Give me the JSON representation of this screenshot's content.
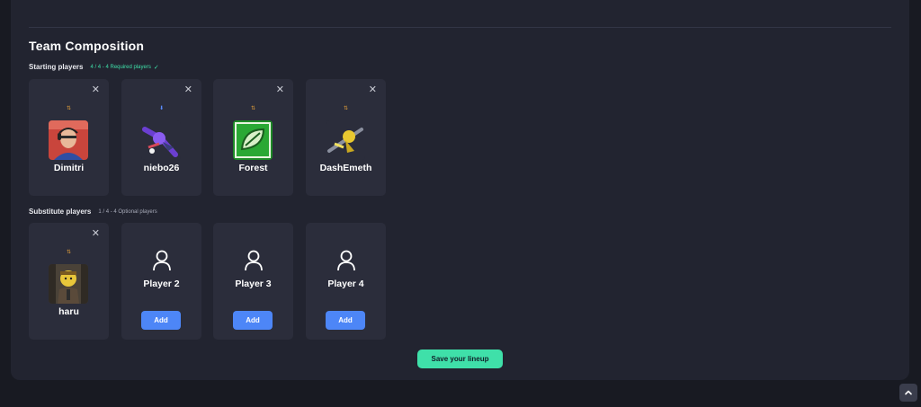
{
  "team": {
    "title": "Team Composition",
    "starting": {
      "label": "Starting players",
      "status": "4 / 4 - 4 Required players",
      "check": "✓",
      "players": [
        {
          "name": "Dimitri",
          "swap": "⇅",
          "swap_color": "orange",
          "avatar": "photo-avatar"
        },
        {
          "name": "niebo26",
          "swap": "⬇",
          "swap_color": "blue",
          "avatar": "squid-avatar-purple"
        },
        {
          "name": "Forest",
          "swap": "⇅",
          "swap_color": "orange",
          "avatar": "leaf-avatar-green"
        },
        {
          "name": "DashEmeth",
          "swap": "⇅",
          "swap_color": "orange",
          "avatar": "squid-avatar-yellow"
        }
      ]
    },
    "substitute": {
      "label": "Substitute players",
      "status": "1 / 4 - 4 Optional players",
      "players": [
        {
          "name": "haru",
          "swap": "⇅",
          "swap_color": "orange",
          "avatar": "figure-avatar-yellow"
        }
      ],
      "empty_slots": [
        {
          "name": "Player 2",
          "add_label": "Add"
        },
        {
          "name": "Player 3",
          "add_label": "Add"
        },
        {
          "name": "Player 4",
          "add_label": "Add"
        }
      ]
    }
  },
  "actions": {
    "close_glyph": "✕",
    "save_label": "Save your lineup"
  },
  "colors": {
    "accent_green": "#3fe0a9",
    "accent_blue": "#4d86f7",
    "panel": "#222430",
    "card": "#2b2d3b"
  },
  "icons": {
    "scroll_top": "chevron-up-icon",
    "empty_user": "user-outline-icon"
  }
}
